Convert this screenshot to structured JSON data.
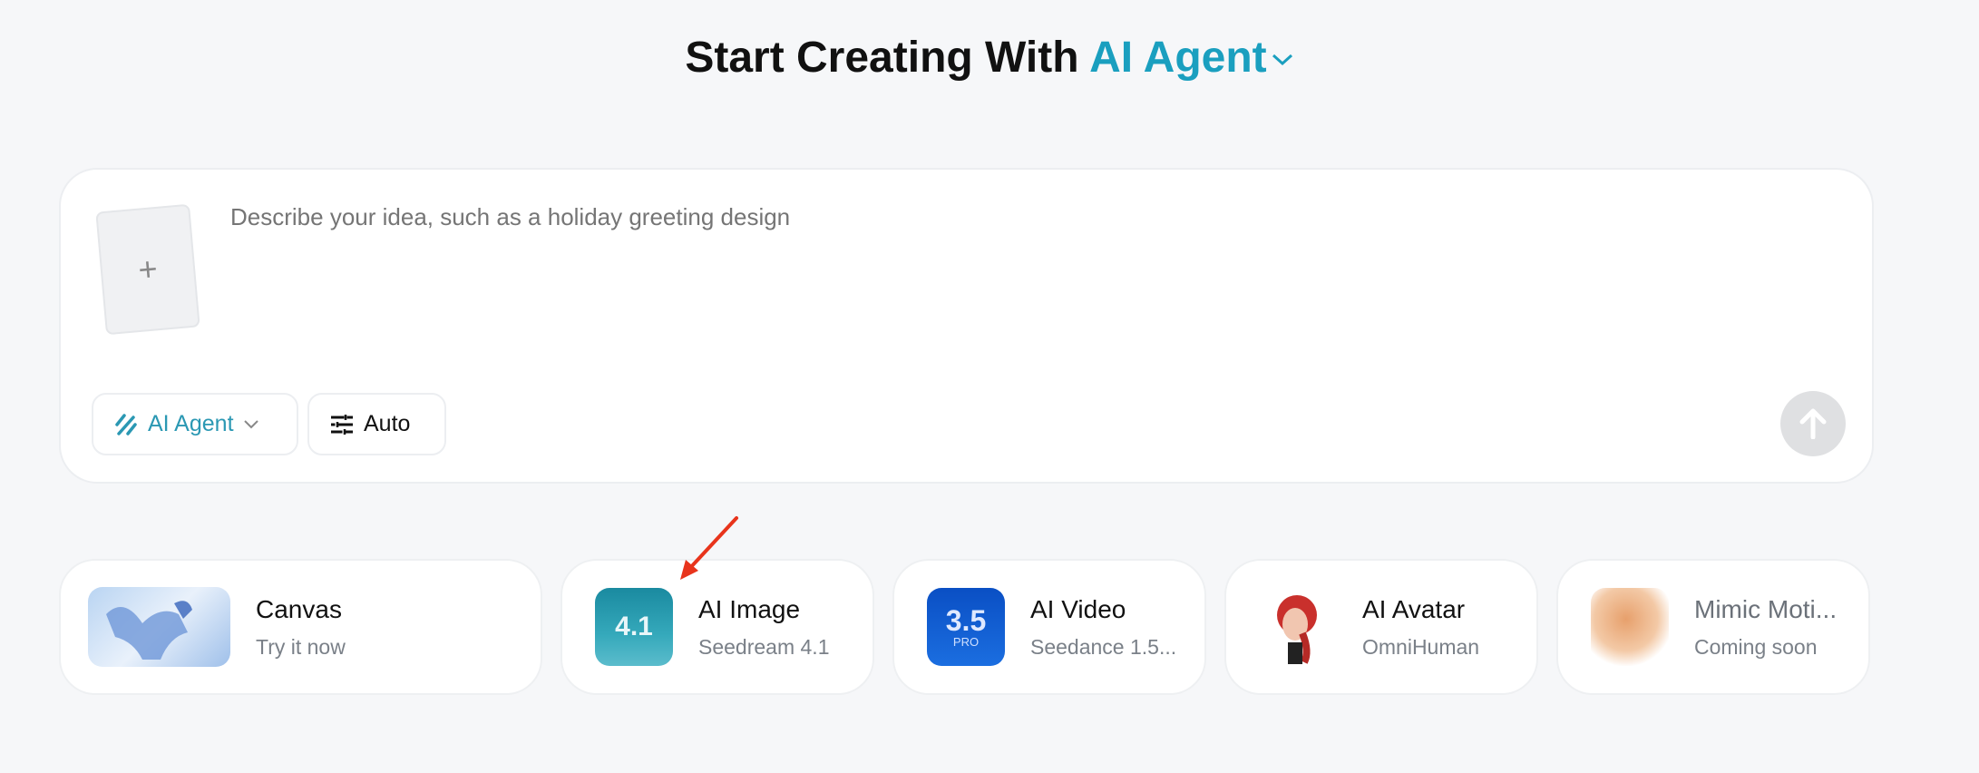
{
  "header": {
    "title_prefix": "Start Creating With",
    "title_accent": "AI Agent"
  },
  "prompt": {
    "placeholder": "Describe your idea, such as a holiday greeting design",
    "upload_symbol": "+",
    "agent_button": "AI Agent",
    "auto_button": "Auto"
  },
  "cards": [
    {
      "title": "Canvas",
      "subtitle": "Try it now"
    },
    {
      "title": "AI Image",
      "subtitle": "Seedream 4.1",
      "badge": "4.1"
    },
    {
      "title": "AI Video",
      "subtitle": "Seedance 1.5...",
      "badge": "3.5",
      "badge_sub": "PRO"
    },
    {
      "title": "AI Avatar",
      "subtitle": "OmniHuman"
    },
    {
      "title": "Mimic Moti...",
      "subtitle": "Coming soon"
    }
  ],
  "colors": {
    "accent": "#1a9fbf",
    "annotation_arrow": "#e8341c"
  }
}
